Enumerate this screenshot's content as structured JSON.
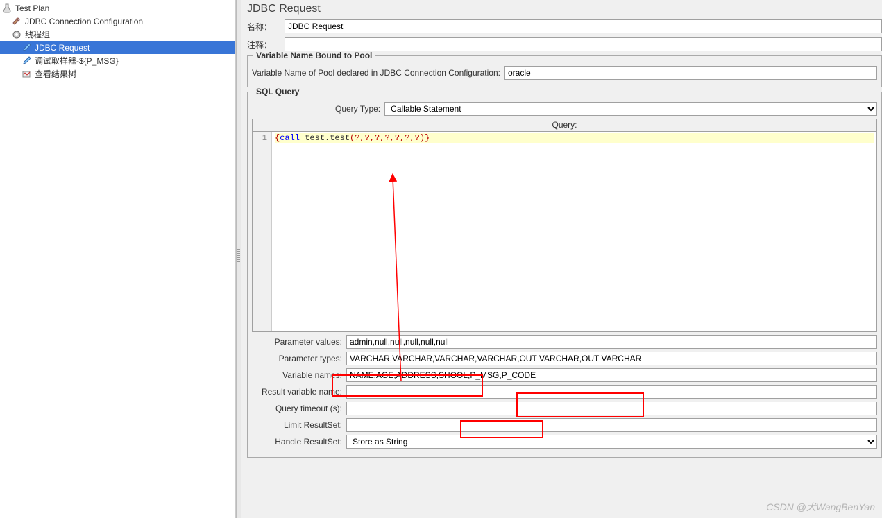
{
  "tree": {
    "test_plan": "Test Plan",
    "jdbc_conn": "JDBC Connection Configuration",
    "thread_group": "线程组",
    "jdbc_request": "JDBC Request",
    "debug_sampler": "调试取样器-${P_MSG}",
    "view_results": "查看结果树"
  },
  "main": {
    "title": "JDBC Request",
    "name_label": "名称：",
    "name_value": "JDBC Request",
    "comment_label": "注释：",
    "comment_value": ""
  },
  "pool": {
    "legend": "Variable Name Bound to Pool",
    "label": "Variable Name of Pool declared in JDBC Connection Configuration:",
    "value": "oracle"
  },
  "sql": {
    "legend": "SQL Query",
    "query_type_label": "Query Type:",
    "query_type_value": "Callable Statement",
    "query_header": "Query:",
    "line_no": "1",
    "code_parts": {
      "open": "{",
      "call": "call",
      "name": " test.test",
      "lparen": "(",
      "args": "?,?,?,?,?,?,?",
      "rparen": ")",
      "close": "}"
    },
    "param_values_label": "Parameter values:",
    "param_values": "admin,null,null,null,null,null",
    "param_types_label": "Parameter types:",
    "param_types": "VARCHAR,VARCHAR,VARCHAR,VARCHAR,OUT VARCHAR,OUT VARCHAR",
    "var_names_label": "Variable names:",
    "var_names": "NAME,AGE,ADDRESS,SHOOL,P_MSG,P_CODE",
    "result_var_label": "Result variable name:",
    "result_var": "",
    "timeout_label": "Query timeout (s):",
    "timeout": "",
    "limit_label": "Limit ResultSet:",
    "limit": "",
    "handle_label": "Handle ResultSet:",
    "handle": "Store as String"
  },
  "watermark": "CSDN @犬WangBenYan"
}
